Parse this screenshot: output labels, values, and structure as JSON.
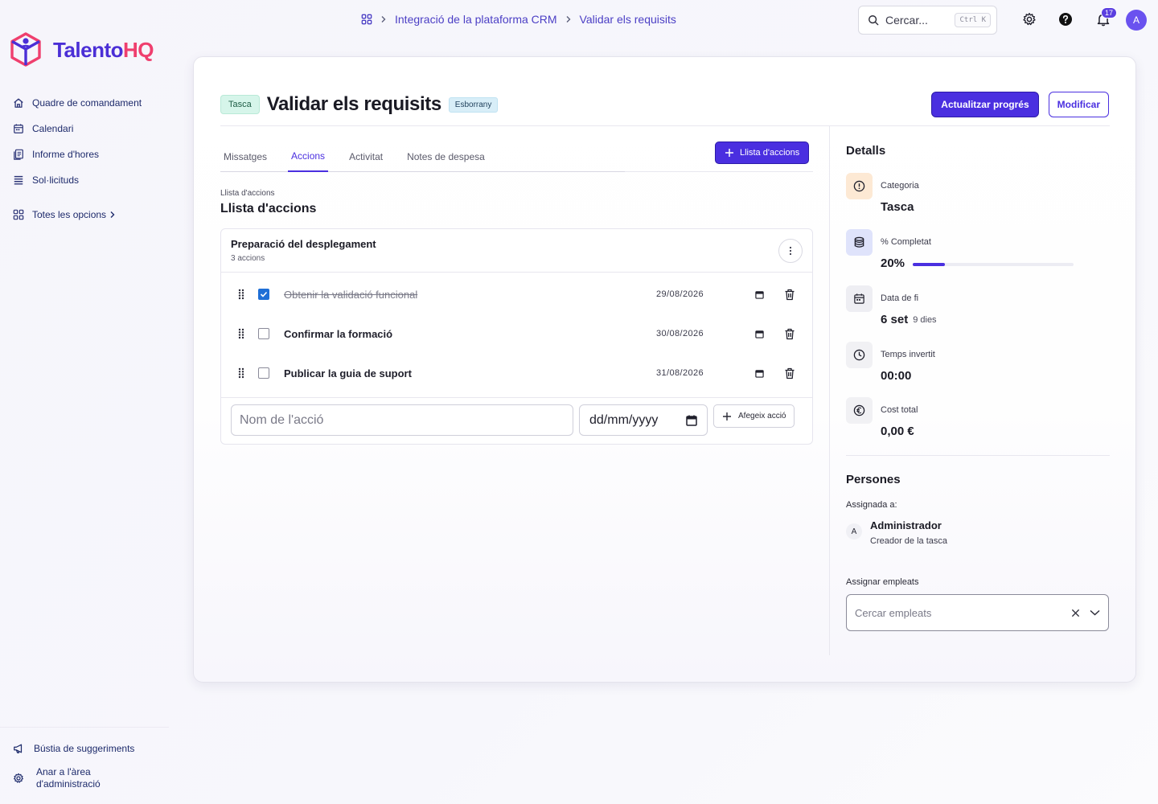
{
  "brand": {
    "name_main": "Talento",
    "name_accent": "HQ",
    "primary": "#4b2fd6",
    "accent": "#ef3f6e"
  },
  "sidebar": {
    "items": [
      {
        "label": "Quadre de comandament",
        "icon": "home-icon"
      },
      {
        "label": "Calendari",
        "icon": "calendar-icon"
      },
      {
        "label": "Informe d'hores",
        "icon": "report-icon"
      },
      {
        "label": "Sol·licituds",
        "icon": "list-icon"
      }
    ],
    "all_options": "Totes les opcions",
    "bottom": [
      {
        "label": "Bústia de suggeriments",
        "icon": "megaphone-icon"
      },
      {
        "label_line1": "Anar a l'àrea",
        "label_line2": "d'administració",
        "icon": "gear-icon"
      }
    ]
  },
  "topbar": {
    "breadcrumb": [
      "Integració de la plataforma CRM",
      "Validar els requisits"
    ],
    "search_placeholder": "Cercar...",
    "search_shortcut": "Ctrl K",
    "notifications_count": "17",
    "avatar_initial": "A"
  },
  "task": {
    "type": "Tasca",
    "title": "Validar els requisits",
    "status": "Esborrany",
    "btn_update": "Actualitzar progrés",
    "btn_edit": "Modificar"
  },
  "tabs": [
    {
      "label": "Missatges",
      "active": false
    },
    {
      "label": "Accions",
      "active": true
    },
    {
      "label": "Activitat",
      "active": false
    },
    {
      "label": "Notes de despesa",
      "active": false
    }
  ],
  "add_list_button": "Llista d'accions",
  "section": {
    "label": "Llista d'accions",
    "title": "Llista d'accions"
  },
  "checklist": {
    "name": "Preparació del desplegament",
    "count": "3 accions",
    "items": [
      {
        "text": "Obtenir la validació funcional",
        "date": "29/08/2026",
        "done": true
      },
      {
        "text": "Confirmar la formació",
        "date": "30/08/2026",
        "done": false
      },
      {
        "text": "Publicar la guia de suport",
        "date": "31/08/2026",
        "done": false
      }
    ],
    "new_name_placeholder": "Nom de l'acció",
    "new_date_placeholder": "dd/mm/yyyy",
    "add_action_button": "Afegeix acció"
  },
  "details": {
    "title": "Detalls",
    "category_label": "Categoria",
    "category_value": "Tasca",
    "completed_label": "% Completat",
    "completed_value": "20%",
    "completed_fraction": 0.2,
    "due_label": "Data de fi",
    "due_value": "6 set",
    "due_sub": "9 dies",
    "time_label": "Temps invertit",
    "time_value": "00:00",
    "cost_label": "Cost total",
    "cost_value": "0,00 €"
  },
  "people": {
    "title": "Persones",
    "assigned_label": "Assignada a:",
    "person_initial": "A",
    "person_name": "Administrador",
    "person_role": "Creador de la tasca",
    "assign_label": "Assignar empleats",
    "assign_placeholder": "Cercar empleats"
  }
}
